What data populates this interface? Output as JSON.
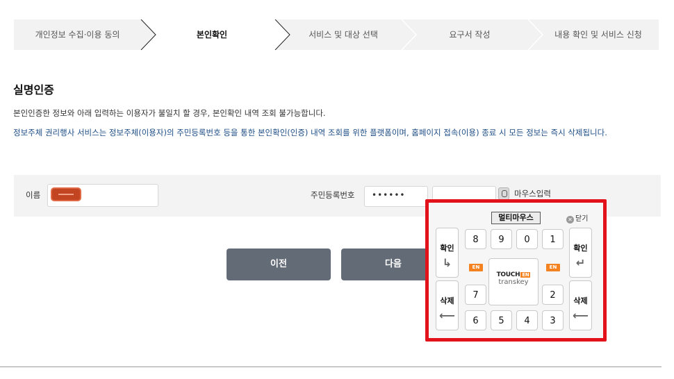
{
  "steps": [
    {
      "label": "개인정보 수집·이용 동의",
      "active": false
    },
    {
      "label": "본인확인",
      "active": true
    },
    {
      "label": "서비스 및 대상 선택",
      "active": false
    },
    {
      "label": "요구서 작성",
      "active": false
    },
    {
      "label": "내용 확인 및 서비스 신청",
      "active": false
    }
  ],
  "section": {
    "title": "실명인증",
    "description": "본인인증한 정보와 아래 입력하는 이용자가 불일치 할 경우, 본인확인 내역 조회 불가능합니다.",
    "notice": "정보주체 권리행사 서비스는 정보주체(이용자)의 주민등록번호 등을 통한 본인확인(인증) 내역 조회를 위한 플랫폼이며, 홈페이지 접속(이용) 종료 시 모든 정보는 즉시 삭제됩니다."
  },
  "form": {
    "name_label": "이름",
    "rrn_label": "주민등록번호",
    "rrn_front_value": "••••••",
    "mouse_input_label": "마우스입력"
  },
  "buttons": {
    "prev": "이전",
    "next": "다음"
  },
  "keypad": {
    "title": "멀티마우스",
    "close_label": "닫기",
    "confirm_label": "확인",
    "delete_label": "삭제",
    "row1": [
      "8",
      "9",
      "0",
      "1"
    ],
    "row2_left": "7",
    "row2_right": "2",
    "row3": [
      "6",
      "5",
      "4",
      "3"
    ],
    "badge": "EN",
    "logo_top": "TOUCH",
    "logo_bottom": "transkey"
  },
  "colors": {
    "button_bg": "#636b76",
    "notice_text": "#1e4e86",
    "keypad_border": "#e3111a",
    "badge": "#f58220"
  }
}
